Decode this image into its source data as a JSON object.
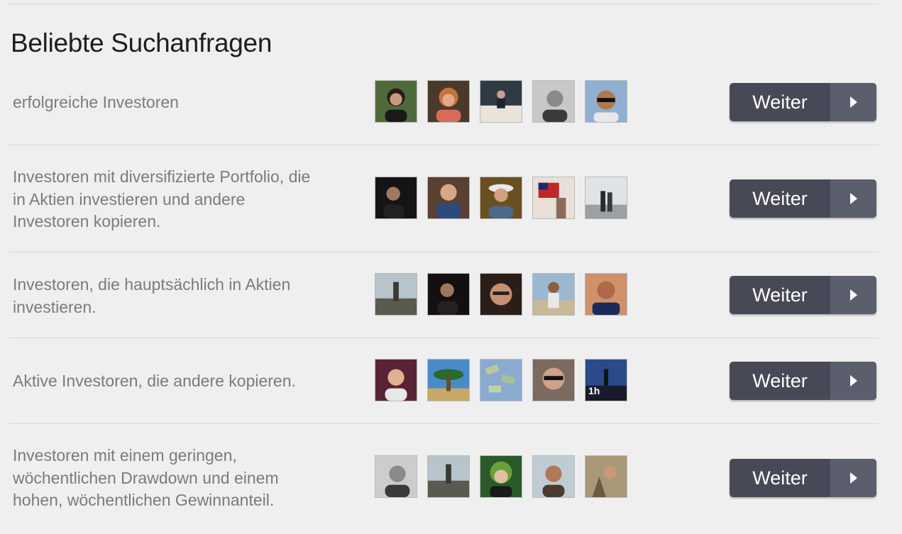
{
  "section": {
    "title": "Beliebte Suchanfragen"
  },
  "rows": [
    {
      "description": "erfolgreiche Investoren",
      "button_label": "Weiter",
      "avatars": [
        "#6b5a3e",
        "#b57a60",
        "#3d4d5c",
        "#8c8c8c",
        "#7a8fa8"
      ]
    },
    {
      "description": "Investoren mit diversifizierte Portfolio, die in Aktien investieren und andere Investoren kopieren.",
      "button_label": "Weiter",
      "avatars": [
        "#1b1b1b",
        "#6b4f3d",
        "#5c4a2a",
        "#c9554a",
        "#b7b7b0"
      ]
    },
    {
      "description": "Investoren, die hauptsächlich in Aktien investieren.",
      "button_label": "Weiter",
      "avatars": [
        "#6d6f6a",
        "#1c1414",
        "#2a2320",
        "#8fa4b8",
        "#a0634a"
      ]
    },
    {
      "description": "Aktive Investoren, die andere kopieren.",
      "button_label": "Weiter",
      "avatars": [
        "#5a2a3a",
        "#3d7aa8",
        "#7a9cc0",
        "#8a7a70",
        "#2b4a7a"
      ],
      "badge": "1h"
    },
    {
      "description": "Investoren mit einem geringen, wöchentlichen Drawdown und einem hohen, wöchentlichen Gewinnanteil.",
      "button_label": "Weiter",
      "avatars": [
        "#7d7d7d",
        "#6d6f6a",
        "#3d6b2a",
        "#b9c5cc",
        "#9a8a70"
      ]
    }
  ]
}
